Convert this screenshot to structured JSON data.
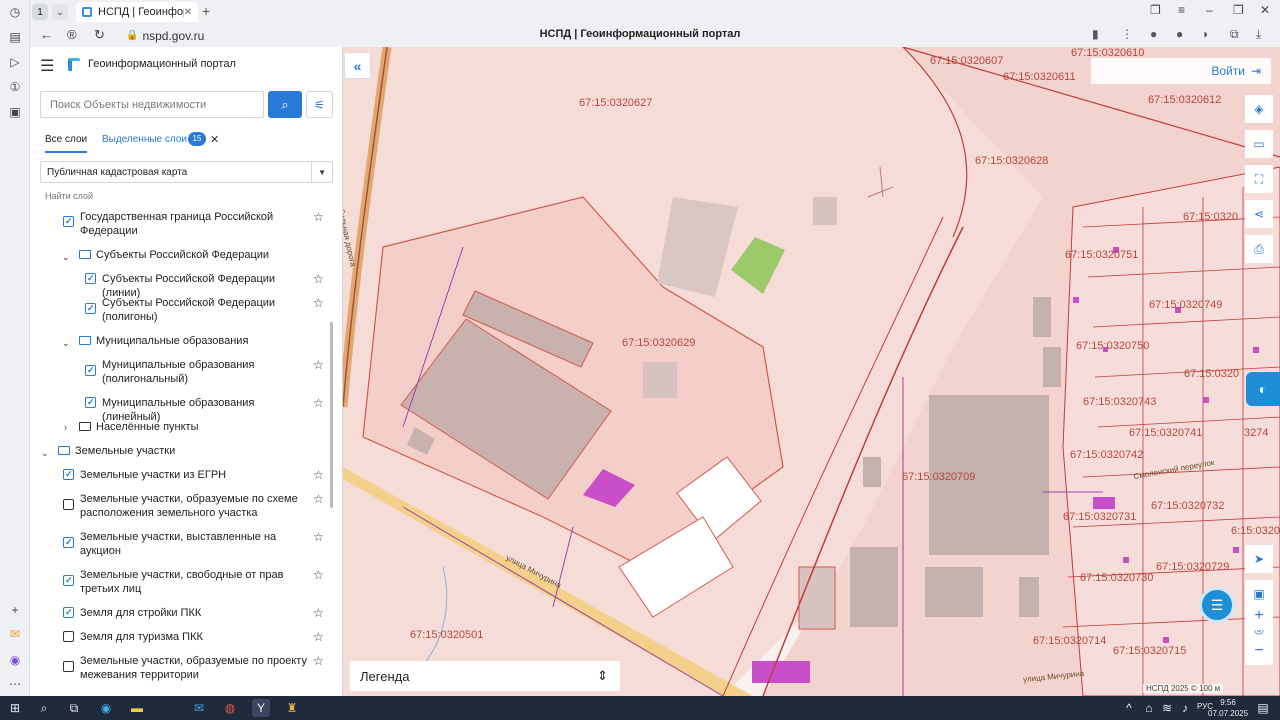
{
  "browser": {
    "tab_count": "1",
    "tab_title": "НСПД | Геоинформационн",
    "url": "nspd.gov.ru",
    "page_title": "НСПД | Геоинформационный портал"
  },
  "panel": {
    "portal_title": "Геоинформационный портал",
    "search_placeholder": "Поиск Объекты недвижимости",
    "tab_all": "Все слои",
    "tab_selected": "Выделенные слои",
    "selected_count": "15",
    "map_select": "Публичная кадастровая карта",
    "find_layer": "Найти слой",
    "tree": [
      {
        "label": "Государственная граница Российской Федерации",
        "checked": true
      },
      {
        "label": "Субъекты Российской Федерации"
      },
      {
        "label": "Субъекты Российской Федерации (линии)",
        "checked": true
      },
      {
        "label": "Субъекты Российской Федерации (полигоны)",
        "checked": true
      },
      {
        "label": "Муниципальные образования"
      },
      {
        "label": "Муниципальные образования (полигональный)",
        "checked": true
      },
      {
        "label": "Муниципальные образования (линейный)",
        "checked": true
      },
      {
        "label": "Населённые пункты"
      },
      {
        "label": "Земельные участки"
      },
      {
        "label": "Земельные участки из ЕГРН",
        "checked": true
      },
      {
        "label": "Земельные участки, образуемые по схеме расположения земельного участка",
        "checked": false
      },
      {
        "label": "Земельные участки, выставленные на аукцион",
        "checked": true
      },
      {
        "label": "Земельные участки, свободные от прав третьих лиц",
        "checked": true
      },
      {
        "label": "Земля для стройки ПКК",
        "checked": true
      },
      {
        "label": "Земля для туризма ПКК",
        "checked": false
      },
      {
        "label": "Земельные участки, образуемые по проекту межевания территории",
        "checked": false
      }
    ]
  },
  "map": {
    "login_label": "Войти",
    "legend_label": "Легенда",
    "scale_info": "НСПД 2025 ©    100 м",
    "street_labels": [
      "улица Мичурина",
      "Смоленская автомобильная дорога",
      "Смоленский переулок",
      "улица Мичурина"
    ],
    "cadastral_labels": [
      "67:15:0320627",
      "67:15:0320607",
      "67:15:0320611",
      "67:15:0320610",
      "67:15:0320612",
      "67:15:0320628",
      "67:15:0320629",
      "67:15:0320751",
      "67:15:0320749",
      "67:15:0320750",
      "67:15:0320",
      "67:15:0320",
      "67:15:0320743",
      "67:15:0320741",
      "67:15:0320742",
      "67:15:0320709",
      "67:15:0320731",
      "67:15:0320732",
      "67:15:0320730",
      "67:15:0320729",
      "67:15:0320714",
      "67:15:0320715",
      "67:15:0320501",
      "6:15:0320",
      "3274"
    ]
  },
  "taskbar": {
    "lang": "РУС",
    "time": "9:56",
    "date": "07.07.2025"
  },
  "colors": {
    "accent": "#2979d6",
    "parcel_fill": "#f4cfc9",
    "parcel_stroke": "#d4584c",
    "building": "#c9b2ad",
    "purple": "#c94fc9",
    "green": "#9cc96a"
  }
}
